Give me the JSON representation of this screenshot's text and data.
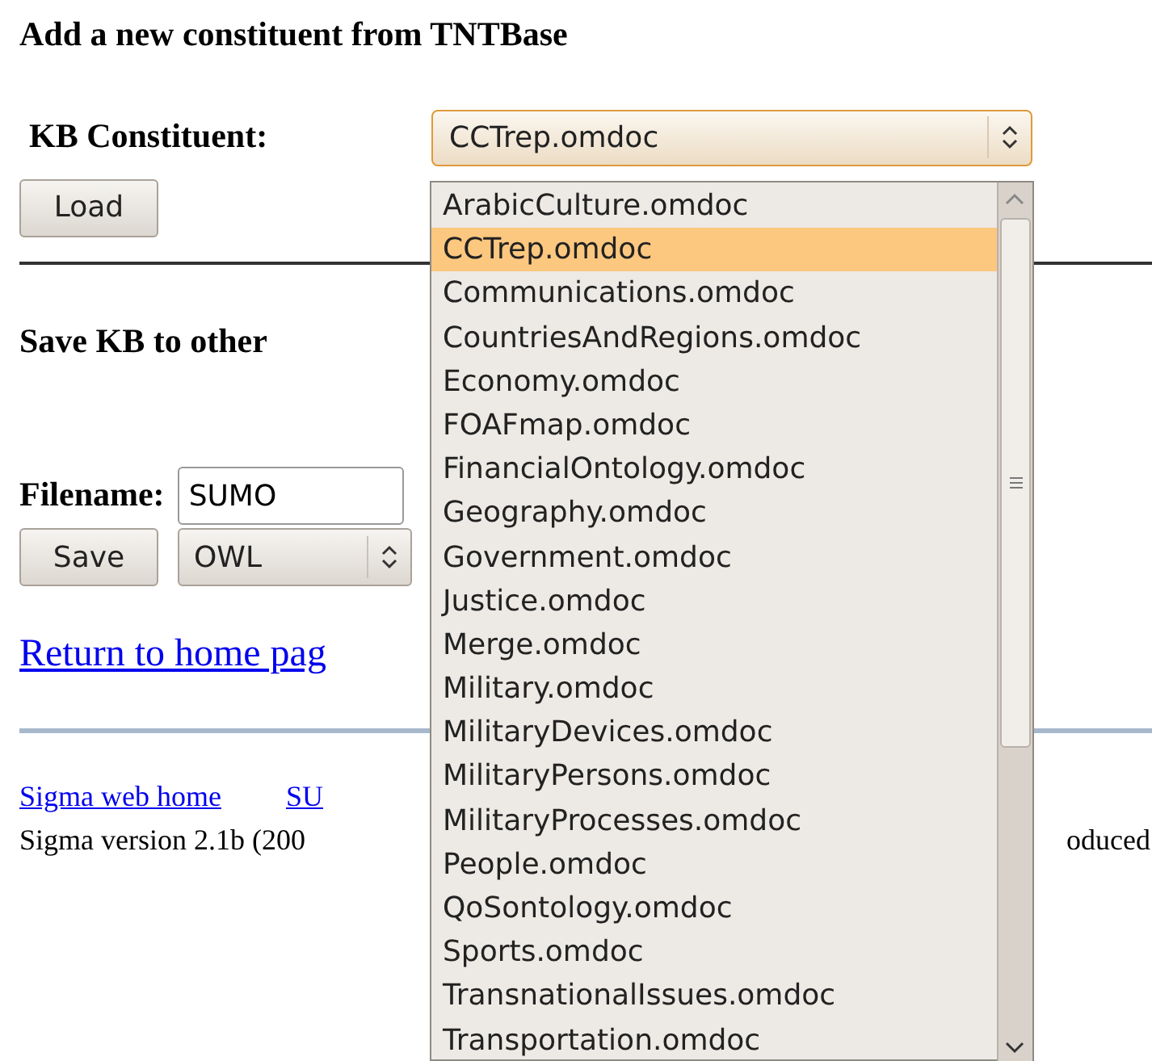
{
  "heading": "Add a new constituent from TNTBase",
  "kb_constituent": {
    "label": "KB Constituent:",
    "value": "CCTrep.omdoc",
    "button": "Load"
  },
  "save_heading": "Save KB to other",
  "filename": {
    "label": "Filename:",
    "value": "SUMO",
    "button": "Save",
    "format": "OWL"
  },
  "return_link": "Return to home pag",
  "footer": {
    "links": [
      "Sigma web home",
      "SU"
    ],
    "version": "Sigma version 2.1b (200",
    "version_end": "oduced"
  },
  "dropdown": {
    "options": [
      {
        "label": "ArabicCulture.omdoc",
        "selected": false
      },
      {
        "label": "CCTrep.omdoc",
        "selected": true
      },
      {
        "label": "Communications.omdoc",
        "selected": false
      },
      {
        "label": "CountriesAndRegions.omdoc",
        "selected": false
      },
      {
        "label": "Economy.omdoc",
        "selected": false
      },
      {
        "label": "FOAFmap.omdoc",
        "selected": false
      },
      {
        "label": "FinancialOntology.omdoc",
        "selected": false
      },
      {
        "label": "Geography.omdoc",
        "selected": false
      },
      {
        "label": "Government.omdoc",
        "selected": false
      },
      {
        "label": "Justice.omdoc",
        "selected": false
      },
      {
        "label": "Merge.omdoc",
        "selected": false
      },
      {
        "label": "Military.omdoc",
        "selected": false
      },
      {
        "label": "MilitaryDevices.omdoc",
        "selected": false
      },
      {
        "label": "MilitaryPersons.omdoc",
        "selected": false
      },
      {
        "label": "MilitaryProcesses.omdoc",
        "selected": false
      },
      {
        "label": "People.omdoc",
        "selected": false
      },
      {
        "label": "QoSontology.omdoc",
        "selected": false
      },
      {
        "label": "Sports.omdoc",
        "selected": false
      },
      {
        "label": "TransnationalIssues.omdoc",
        "selected": false
      },
      {
        "label": "Transportation.omdoc",
        "selected": false
      }
    ]
  }
}
